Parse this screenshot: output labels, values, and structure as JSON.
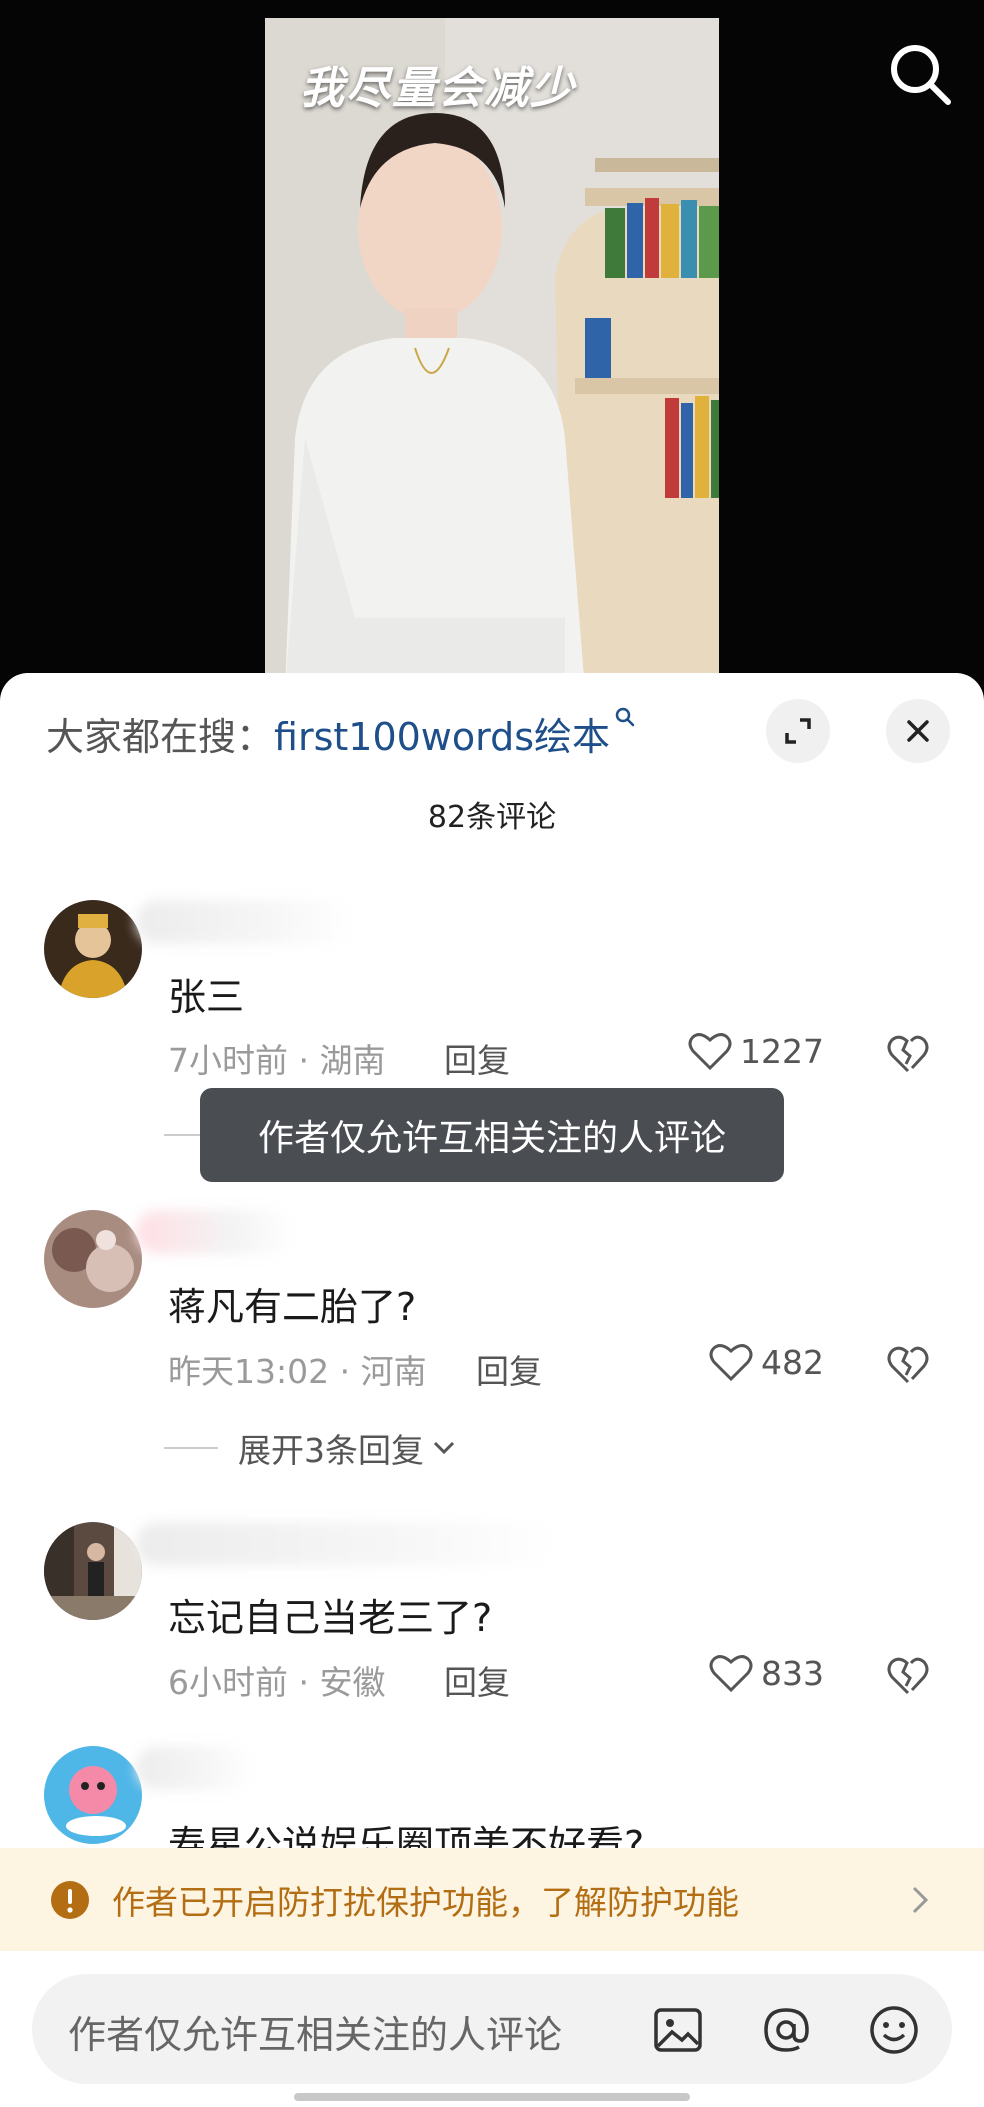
{
  "video": {
    "caption": "我尽量会减少",
    "search_icon": "search-icon"
  },
  "panel": {
    "trending_label": "大家都在搜：",
    "trending_keyword": "first100words绘本",
    "comment_count": "82条评论"
  },
  "comments": [
    {
      "text": "张三",
      "time": "7小时前",
      "location": "湖南",
      "reply": "回复",
      "likes": "1227"
    },
    {
      "text": "蒋凡有二胎了?",
      "time": "昨天13:02",
      "location": "河南",
      "reply": "回复",
      "likes": "482",
      "expand_replies": "展开3条回复"
    },
    {
      "text": "忘记自己当老三了?",
      "time": "6小时前",
      "location": "安徽",
      "reply": "回复",
      "likes": "833"
    },
    {
      "text": "寿星公说娱乐圈顶美不好看?"
    }
  ],
  "toast": "作者仅允许互相关注的人评论",
  "banner": {
    "text": "作者已开启防打扰保护功能，了解防护功能"
  },
  "input": {
    "placeholder": "作者仅允许互相关注的人评论"
  },
  "colors": {
    "accent_link": "#1e4f8a",
    "banner_bg": "#fdf4e2",
    "banner_text": "#b36d13",
    "toast_bg": "#4a4d52"
  }
}
